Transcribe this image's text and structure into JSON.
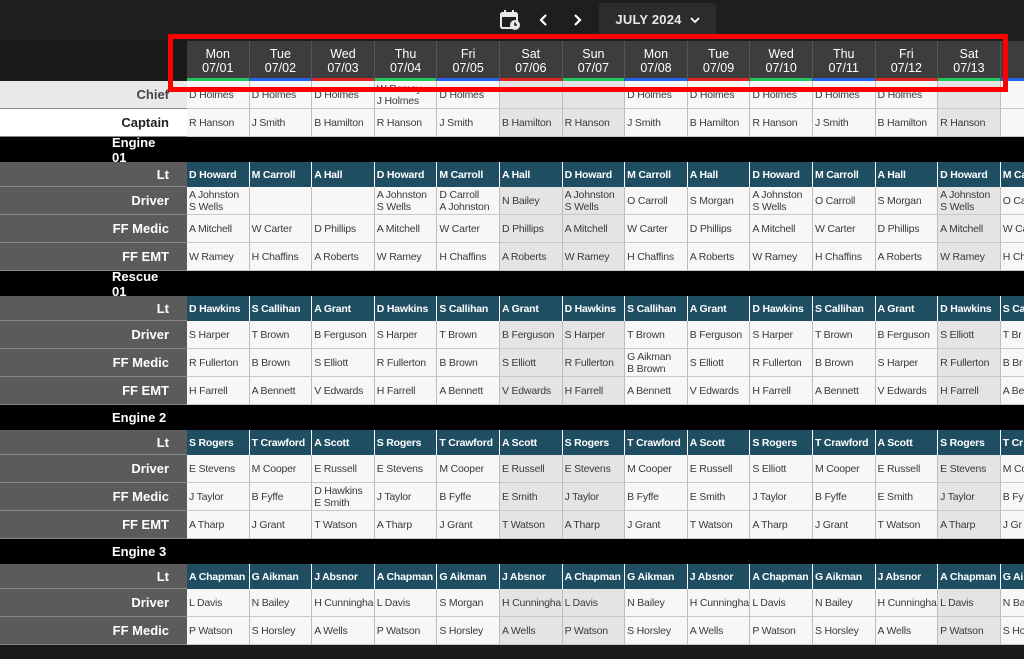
{
  "toolbar": {
    "month": "JULY 2024",
    "calendar_icon": "calendar-icon",
    "prev_icon": "chevron-left-icon",
    "next_icon": "chevron-right-icon"
  },
  "colors": {
    "green": "#22c55e",
    "blue": "#2563eb",
    "red": "#dc2626",
    "lt_bg": "#1f4e63"
  },
  "days": [
    {
      "dow": "Mon",
      "date": "07/01",
      "bar": "green"
    },
    {
      "dow": "Tue",
      "date": "07/02",
      "bar": "blue"
    },
    {
      "dow": "Wed",
      "date": "07/03",
      "bar": "red"
    },
    {
      "dow": "Thu",
      "date": "07/04",
      "bar": "green"
    },
    {
      "dow": "Fri",
      "date": "07/05",
      "bar": "blue"
    },
    {
      "dow": "Sat",
      "date": "07/06",
      "bar": "red"
    },
    {
      "dow": "Sun",
      "date": "07/07",
      "bar": "green"
    },
    {
      "dow": "Mon",
      "date": "07/08",
      "bar": "blue"
    },
    {
      "dow": "Tue",
      "date": "07/09",
      "bar": "red"
    },
    {
      "dow": "Wed",
      "date": "07/10",
      "bar": "green"
    },
    {
      "dow": "Thu",
      "date": "07/11",
      "bar": "blue"
    },
    {
      "dow": "Fri",
      "date": "07/12",
      "bar": "red"
    },
    {
      "dow": "Sat",
      "date": "07/13",
      "bar": "green"
    },
    {
      "dow": "",
      "date": "",
      "bar": "blue"
    }
  ],
  "rows": [
    {
      "type": "role",
      "label": "Chief",
      "cells": [
        "D Holmes",
        "D Holmes",
        "D Holmes",
        "W Ramey\nJ Holmes",
        "D Holmes",
        "",
        "",
        "D Holmes",
        "D Holmes",
        "D Holmes",
        "D Holmes",
        "D Holmes",
        "",
        ""
      ]
    },
    {
      "type": "role",
      "label": "Captain",
      "cells": [
        "R Hanson",
        "J Smith",
        "B Hamilton",
        "R Hanson",
        "J Smith",
        "B Hamilton",
        "R Hanson",
        "J Smith",
        "B Hamilton",
        "R Hanson",
        "J Smith",
        "B Hamilton",
        "R Hanson",
        ""
      ]
    },
    {
      "type": "unit",
      "label": "Engine 01"
    },
    {
      "type": "lt",
      "label": "Lt",
      "cells": [
        "D Howard",
        "M Carroll",
        "A Hall",
        "D Howard",
        "M Carroll",
        "A Hall",
        "D Howard",
        "M Carroll",
        "A Hall",
        "D Howard",
        "M Carroll",
        "A Hall",
        "D Howard",
        "M Ca"
      ]
    },
    {
      "type": "role",
      "label": "Driver",
      "cells": [
        "A Johnston\nS Wells",
        "",
        "",
        "A Johnston\nS Wells",
        "D Carroll\nA Johnston",
        "N Bailey",
        "A Johnston\nS Wells",
        "O Carroll",
        "S Morgan",
        "A Johnston\nS Wells",
        "O Carroll",
        "S Morgan",
        "A Johnston\nS Wells",
        "O Ca"
      ]
    },
    {
      "type": "role",
      "label": "FF Medic",
      "cells": [
        "A Mitchell",
        "W Carter",
        "D Phillips",
        "A Mitchell",
        "W Carter",
        "D Phillips",
        "A Mitchell",
        "W Carter",
        "D Phillips",
        "A Mitchell",
        "W Carter",
        "D Phillips",
        "A Mitchell",
        "W Ca"
      ]
    },
    {
      "type": "role",
      "label": "FF EMT",
      "cells": [
        "W Ramey",
        "H Chaffins",
        "A Roberts",
        "W Ramey",
        "H Chaffins",
        "A Roberts",
        "W Ramey",
        "H Chaffins",
        "A Roberts",
        "W Ramey",
        "H Chaffins",
        "A Roberts",
        "W Ramey",
        "H Ch"
      ]
    },
    {
      "type": "unit",
      "label": "Rescue 01"
    },
    {
      "type": "lt",
      "label": "Lt",
      "cells": [
        "D Hawkins",
        "S Callihan",
        "A Grant",
        "D Hawkins",
        "S Callihan",
        "A Grant",
        "D Hawkins",
        "S Callihan",
        "A Grant",
        "D Hawkins",
        "S Callihan",
        "A Grant",
        "D Hawkins",
        "S Ca"
      ]
    },
    {
      "type": "role",
      "label": "Driver",
      "cells": [
        "S Harper",
        "T Brown",
        "B Ferguson",
        "S Harper",
        "T Brown",
        "B Ferguson",
        "S Harper",
        "T Brown",
        "B Ferguson",
        "S Harper",
        "T Brown",
        "B Ferguson",
        "S Elliott",
        "T Br"
      ]
    },
    {
      "type": "role",
      "label": "FF Medic",
      "cells": [
        "R Fullerton",
        "B Brown",
        "S Elliott",
        "R Fullerton",
        "B Brown",
        "S Elliott",
        "R Fullerton",
        "G Aikman\nB Brown",
        "S Elliott",
        "R Fullerton",
        "B Brown",
        "S Harper",
        "R Fullerton",
        "B Br"
      ]
    },
    {
      "type": "role",
      "label": "FF EMT",
      "cells": [
        "H Farrell",
        "A Bennett",
        "V Edwards",
        "H Farrell",
        "A Bennett",
        "V Edwards",
        "H Farrell",
        "A Bennett",
        "V Edwards",
        "H Farrell",
        "A Bennett",
        "V Edwards",
        "H Farrell",
        "A Be"
      ]
    },
    {
      "type": "unit",
      "label": "Engine 2"
    },
    {
      "type": "lt",
      "label": "Lt",
      "cells": [
        "S Rogers",
        "T Crawford",
        "A Scott",
        "S Rogers",
        "T Crawford",
        "A Scott",
        "S Rogers",
        "T Crawford",
        "A Scott",
        "S Rogers",
        "T Crawford",
        "A Scott",
        "S Rogers",
        "T Cr"
      ]
    },
    {
      "type": "role",
      "label": "Driver",
      "cells": [
        "E Stevens",
        "M Cooper",
        "E Russell",
        "E Stevens",
        "M Cooper",
        "E Russell",
        "E Stevens",
        "M Cooper",
        "E Russell",
        "S Elliott",
        "M Cooper",
        "E Russell",
        "E Stevens",
        "M Co"
      ]
    },
    {
      "type": "role",
      "label": "FF Medic",
      "cells": [
        "J Taylor",
        "B Fyffe",
        "D Hawkins\nE Smith",
        "J Taylor",
        "B Fyffe",
        "E Smith",
        "J Taylor",
        "B Fyffe",
        "E Smith",
        "J Taylor",
        "B Fyffe",
        "E Smith",
        "J Taylor",
        "B Fy"
      ]
    },
    {
      "type": "role",
      "label": "FF EMT",
      "cells": [
        "A Tharp",
        "J Grant",
        "T Watson",
        "A Tharp",
        "J Grant",
        "T Watson",
        "A Tharp",
        "J Grant",
        "T Watson",
        "A Tharp",
        "J Grant",
        "T Watson",
        "A Tharp",
        "J Gr"
      ]
    },
    {
      "type": "unit",
      "label": "Engine 3"
    },
    {
      "type": "lt",
      "label": "Lt",
      "cells": [
        "A Chapman",
        "G Aikman",
        "J Absnor",
        "A Chapman",
        "G Aikman",
        "J Absnor",
        "A Chapman",
        "G Aikman",
        "J Absnor",
        "A Chapman",
        "G Aikman",
        "J Absnor",
        "A Chapman",
        "G Ai"
      ]
    },
    {
      "type": "role",
      "label": "Driver",
      "cells": [
        "L Davis",
        "N Bailey",
        "H Cunningha",
        "L Davis",
        "S Morgan",
        "H Cunningha",
        "L Davis",
        "N Bailey",
        "H Cunningha",
        "L Davis",
        "N Bailey",
        "H Cunningha",
        "L Davis",
        "N Ba"
      ]
    },
    {
      "type": "role",
      "label": "FF Medic",
      "cells": [
        "P Watson",
        "S Horsley",
        "A Wells",
        "P Watson",
        "S Horsley",
        "A Wells",
        "P Watson",
        "S Horsley",
        "A Wells",
        "P Watson",
        "S Horsley",
        "A Wells",
        "P Watson",
        "S Ho"
      ]
    }
  ]
}
